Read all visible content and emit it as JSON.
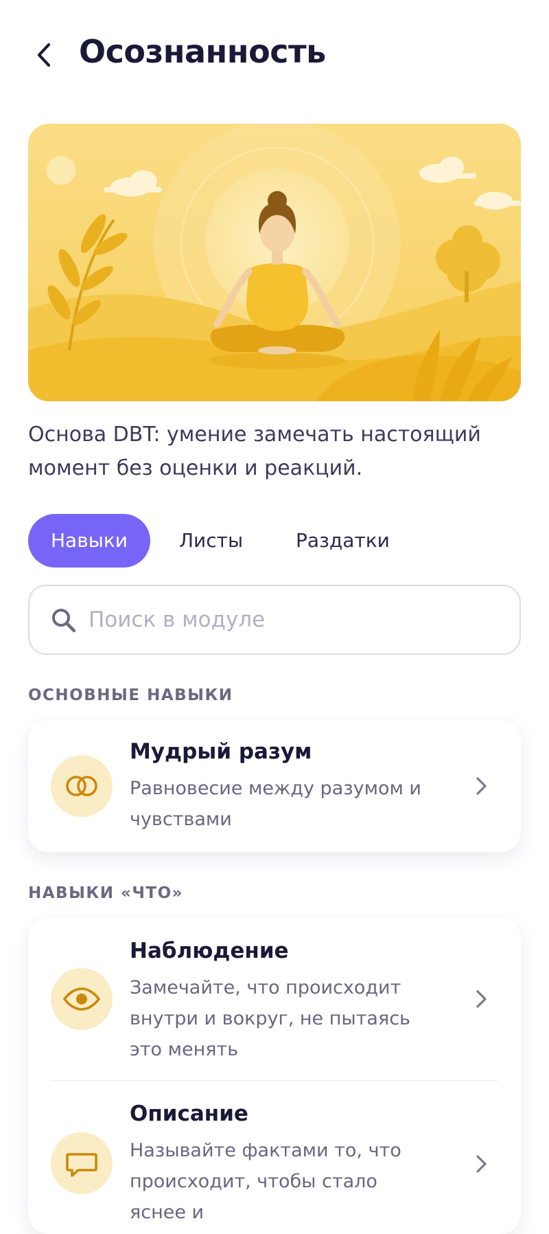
{
  "header": {
    "title": "Осознанность"
  },
  "description": "Основа DBT: умение замечать настоящий момент без оценки и реакций.",
  "tabs": [
    {
      "label": "Навыки",
      "active": true
    },
    {
      "label": "Листы",
      "active": false
    },
    {
      "label": "Раздатки",
      "active": false
    }
  ],
  "search": {
    "placeholder": "Поиск в модуле",
    "value": ""
  },
  "sections": [
    {
      "label": "ОСНОВНЫЕ НАВЫКИ",
      "items": [
        {
          "title": "Мудрый разум",
          "subtitle": "Равновесие между разумом и чувствами",
          "icon": "rings-icon"
        }
      ]
    },
    {
      "label": "НАВЫКИ «ЧТО»",
      "items": [
        {
          "title": "Наблюдение",
          "subtitle": "Замечайте, что происходит внутри и вокруг, не пытаясь это менять",
          "icon": "eye-icon"
        },
        {
          "title": "Описание",
          "subtitle": "Называйте фактами то, что происходит, чтобы стало яснее и",
          "icon": "speech-bubble-icon"
        }
      ]
    }
  ],
  "colors": {
    "accent": "#7665f7",
    "hero_background": "#f7d56b",
    "icon_circle": "#faecc4",
    "icon_glyph": "#c98a0c"
  }
}
